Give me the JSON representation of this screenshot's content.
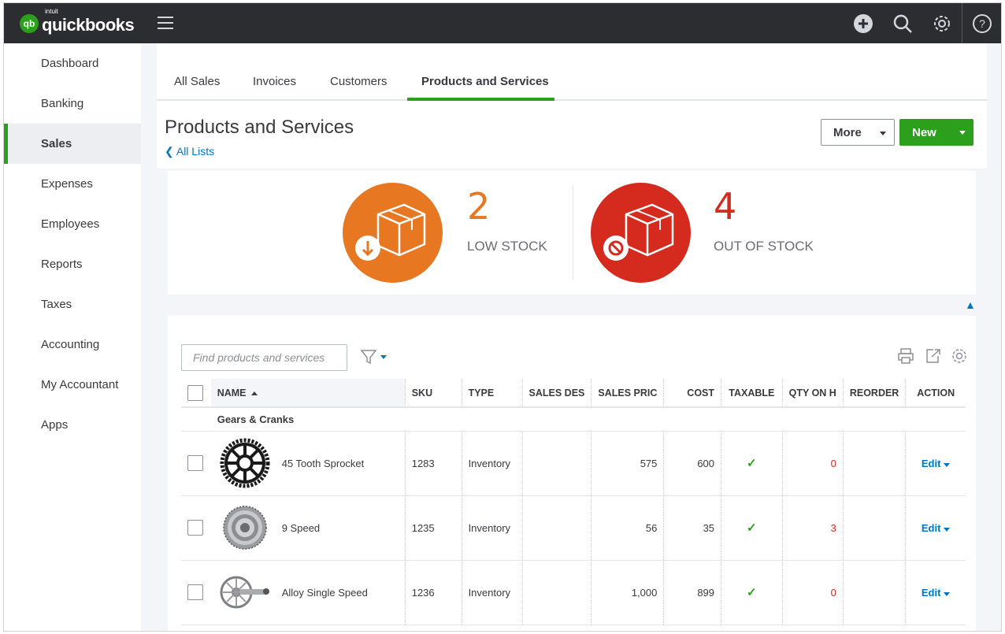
{
  "brand": {
    "small": "intuit",
    "name": "quickbooks",
    "badge": "qb",
    "color": "#2ca01c"
  },
  "topbar": {
    "icons": [
      "plus-icon",
      "search-icon",
      "gear-icon",
      "help-icon"
    ]
  },
  "sidebar": {
    "items": [
      {
        "label": "Dashboard"
      },
      {
        "label": "Banking"
      },
      {
        "label": "Sales",
        "active": true
      },
      {
        "label": "Expenses"
      },
      {
        "label": "Employees"
      },
      {
        "label": "Reports"
      },
      {
        "label": "Taxes"
      },
      {
        "label": "Accounting"
      },
      {
        "label": "My Accountant"
      },
      {
        "label": "Apps"
      }
    ]
  },
  "tabs": [
    {
      "label": "All Sales"
    },
    {
      "label": "Invoices"
    },
    {
      "label": "Customers"
    },
    {
      "label": "Products and Services",
      "active": true
    }
  ],
  "page": {
    "title": "Products and Services",
    "back_link": "All Lists",
    "more_label": "More",
    "new_label": "New"
  },
  "stock": {
    "low": {
      "count": "2",
      "label": "LOW STOCK",
      "color": "#e87722"
    },
    "out": {
      "count": "4",
      "label": "OUT OF STOCK",
      "color": "#d52b1e"
    }
  },
  "list": {
    "search_placeholder": "Find products and services",
    "columns": [
      "NAME",
      "SKU",
      "TYPE",
      "SALES DES",
      "SALES PRIC",
      "COST",
      "TAXABLE",
      "QTY ON H",
      "REORDER",
      "ACTION"
    ],
    "group": "Gears & Cranks",
    "rows": [
      {
        "name": "45 Tooth Sprocket",
        "sku": "1283",
        "type": "Inventory",
        "sales_desc": "",
        "sales_price": "575",
        "cost": "600",
        "taxable": "✓",
        "qty": "0",
        "reorder": "",
        "action": "Edit"
      },
      {
        "name": "9 Speed",
        "sku": "1235",
        "type": "Inventory",
        "sales_desc": "",
        "sales_price": "56",
        "cost": "35",
        "taxable": "✓",
        "qty": "3",
        "reorder": "",
        "action": "Edit"
      },
      {
        "name": "Alloy Single Speed",
        "sku": "1236",
        "type": "Inventory",
        "sales_desc": "",
        "sales_price": "1,000",
        "cost": "899",
        "taxable": "✓",
        "qty": "0",
        "reorder": "",
        "action": "Edit"
      }
    ]
  }
}
